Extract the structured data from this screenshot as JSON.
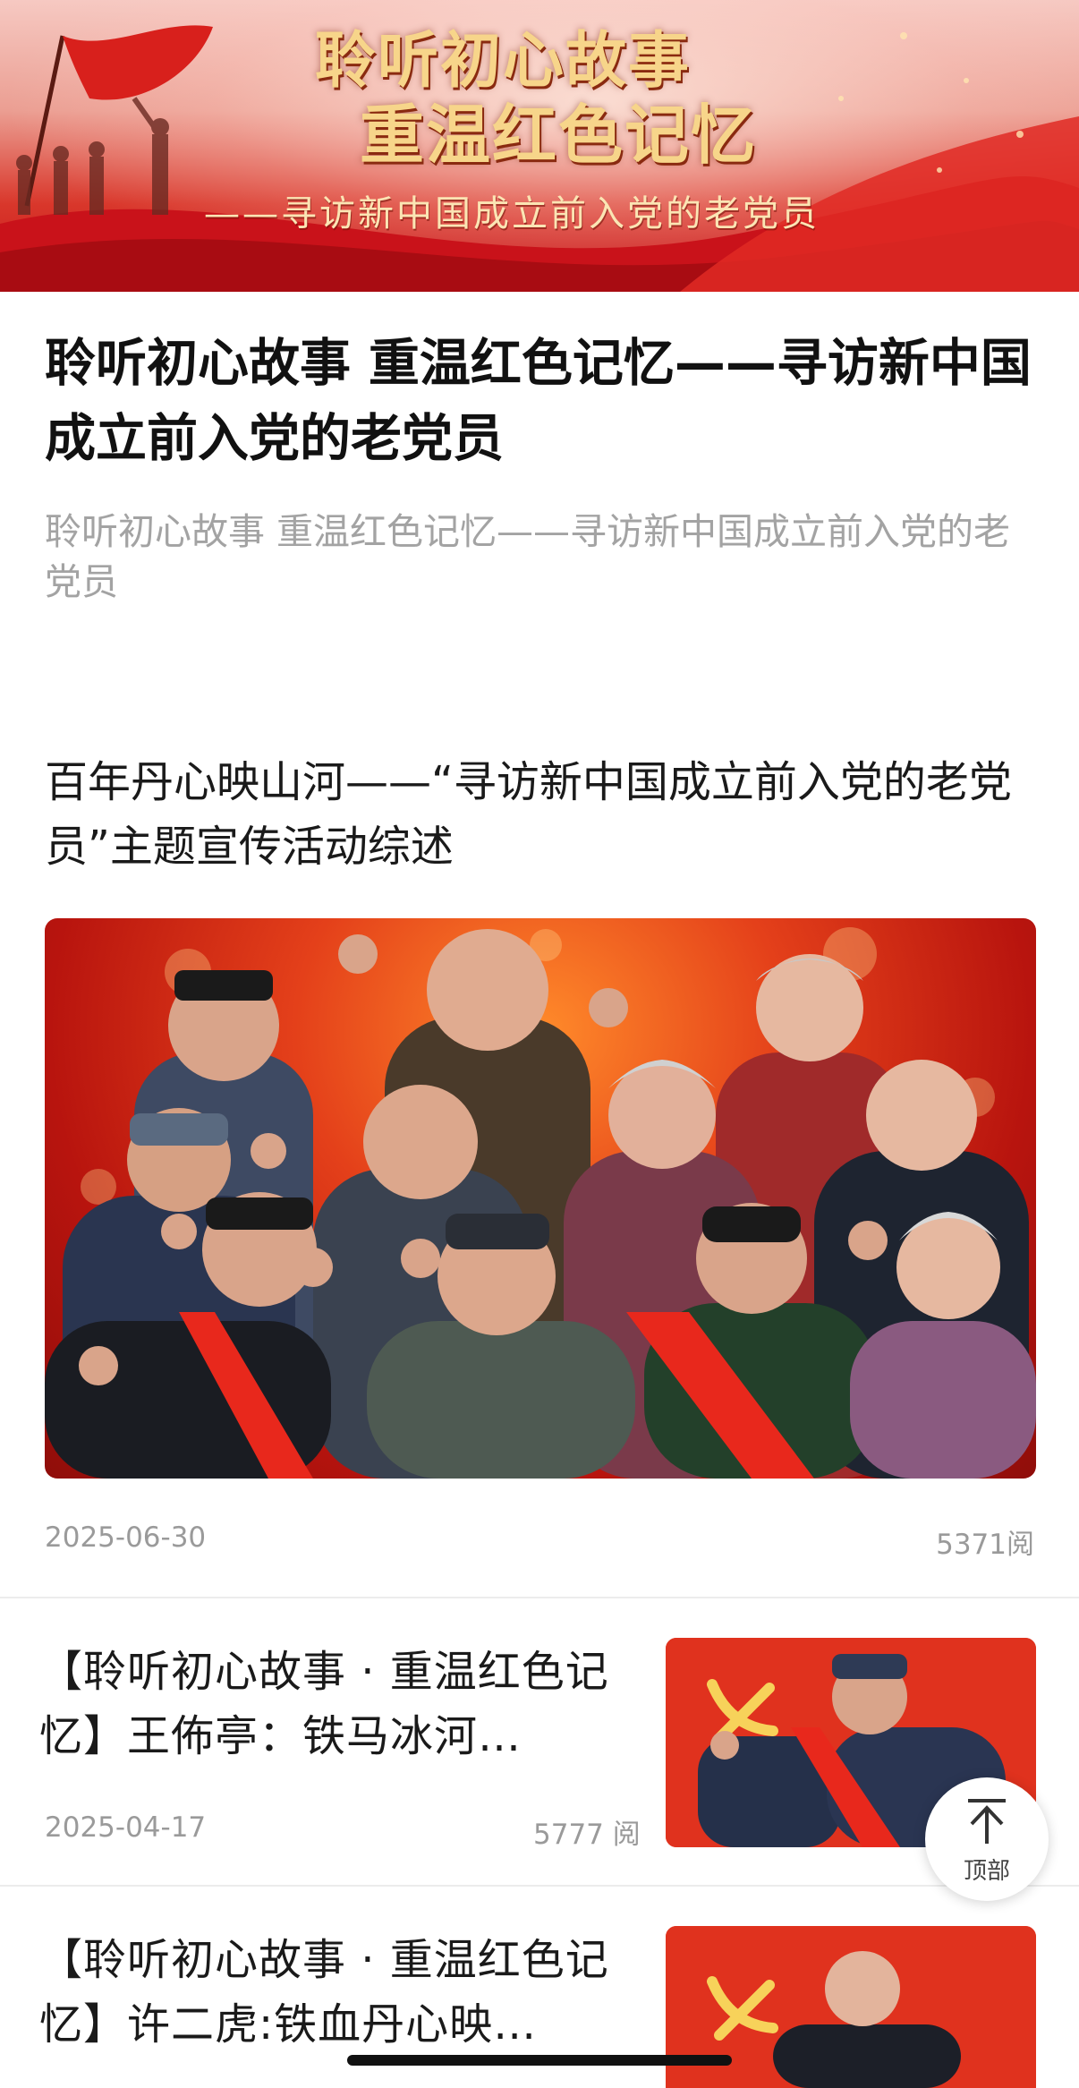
{
  "banner": {
    "title_line1": "聆听初心故事",
    "title_line2": "重温红色记忆",
    "subtitle": "——寻访新中国成立前入党的老党员"
  },
  "headline": "聆听初心故事 重温红色记忆——寻访新中国成立前入党的老党员",
  "summary": "聆听初心故事 重温红色记忆——寻访新中国成立前入党的老党员",
  "featured": {
    "title": "百年丹心映山河——“寻访新中国成立前入党的老党员”主题宣传活动综述",
    "date": "2025-06-30",
    "reads": "5371阅"
  },
  "articles": [
    {
      "title": "【聆听初心故事 · 重温红色记忆】王佈亭：铁马冰河…",
      "date": "2025-04-17",
      "reads": "5777 阅"
    },
    {
      "title": "【聆听初心故事 · 重温红色记忆】许二虎:铁血丹心映…"
    }
  ],
  "back_to_top": {
    "label": "顶部"
  },
  "colors": {
    "party_red": "#e0321e",
    "gold": "#f7d58a",
    "meta_gray": "#9a9a9a"
  }
}
